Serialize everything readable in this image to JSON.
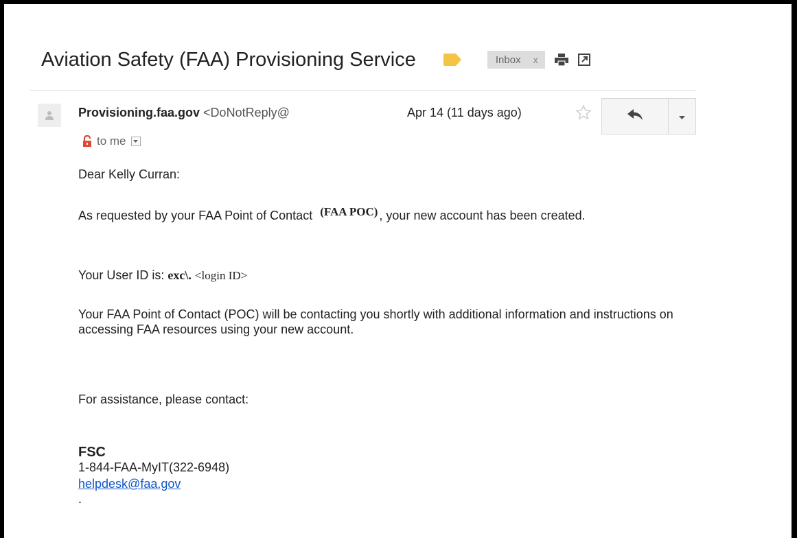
{
  "subject": "Aviation Safety (FAA) Provisioning Service",
  "labels": {
    "inbox": "Inbox",
    "remove": "x"
  },
  "colors": {
    "label_tag": "#f6c443",
    "link": "#1155cc",
    "lock": "#dd4b39"
  },
  "sender": {
    "name": "Provisioning.faa.gov",
    "email": "<DoNotReply@"
  },
  "date": "Apr 14 (11 days ago)",
  "recipient": "to me",
  "body": {
    "greeting": "Dear Kelly Curran:",
    "request_prefix": "As requested by your FAA Point of Contact",
    "poc_placeholder": "(FAA POC)",
    "request_suffix": ", your new account has been created.",
    "userid_prefix": "Your User ID is:",
    "userid_domain": "exc\\.",
    "userid_placeholder": "<login ID>",
    "contact_note": "Your FAA Point of Contact (POC) will be contacting you shortly with additional information and instructions on accessing FAA resources using your new account.",
    "assistance": "For assistance, please contact:",
    "fsc": "FSC",
    "phone": "1-844-FAA-MyIT(322-6948)",
    "helpdesk_email": "helpdesk@faa.gov",
    "trailing": "."
  },
  "icons": [
    "label-tag-icon",
    "print-icon",
    "popout-icon",
    "avatar-icon",
    "star-icon",
    "reply-icon",
    "dropdown-caret-icon",
    "lock-icon"
  ]
}
